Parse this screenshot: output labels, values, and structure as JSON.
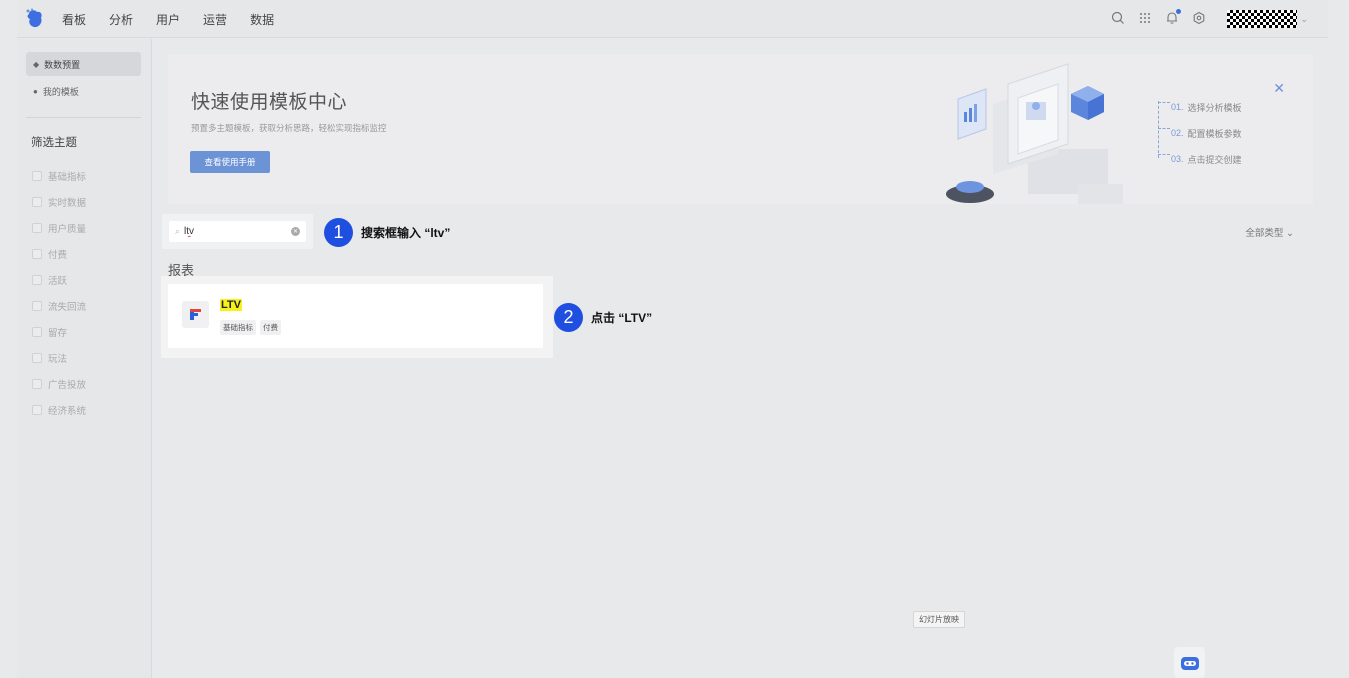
{
  "nav": {
    "items": [
      "看板",
      "分析",
      "用户",
      "运营",
      "数据"
    ]
  },
  "top_icons": [
    "search-icon",
    "apps-grid-icon",
    "bell-icon",
    "settings-icon"
  ],
  "sidebar": {
    "links": [
      {
        "label": "数数预置",
        "icon": "tag-icon",
        "active": true
      },
      {
        "label": "我的模板",
        "icon": "user-icon",
        "active": false
      }
    ],
    "filter_title": "筛选主题",
    "filters": [
      "基础指标",
      "实时数据",
      "用户质量",
      "付费",
      "活跃",
      "流失回流",
      "留存",
      "玩法",
      "广告投放",
      "经济系统"
    ]
  },
  "banner": {
    "title": "快速使用模板中心",
    "subtitle": "预置多主题模板，获取分析思路，轻松实现指标监控",
    "button": "查看使用手册",
    "steps": [
      {
        "num": "01.",
        "label": "选择分析模板"
      },
      {
        "num": "02.",
        "label": "配置模板参数"
      },
      {
        "num": "03.",
        "label": "点击提交创建"
      }
    ]
  },
  "search": {
    "value": "ltv"
  },
  "type_filter": "全部类型",
  "section_title": "报表",
  "result": {
    "title": "LTV",
    "tags": [
      "基础指标",
      "付费"
    ]
  },
  "callouts": [
    {
      "num": "1",
      "text": "搜索框输入 “ltv”"
    },
    {
      "num": "2",
      "text": "点击 “LTV”"
    }
  ],
  "slideshow_tip": "幻灯片放映",
  "colors": {
    "accent": "#1e4fe0",
    "button": "#6c93d6",
    "highlight": "#f7f01a"
  }
}
